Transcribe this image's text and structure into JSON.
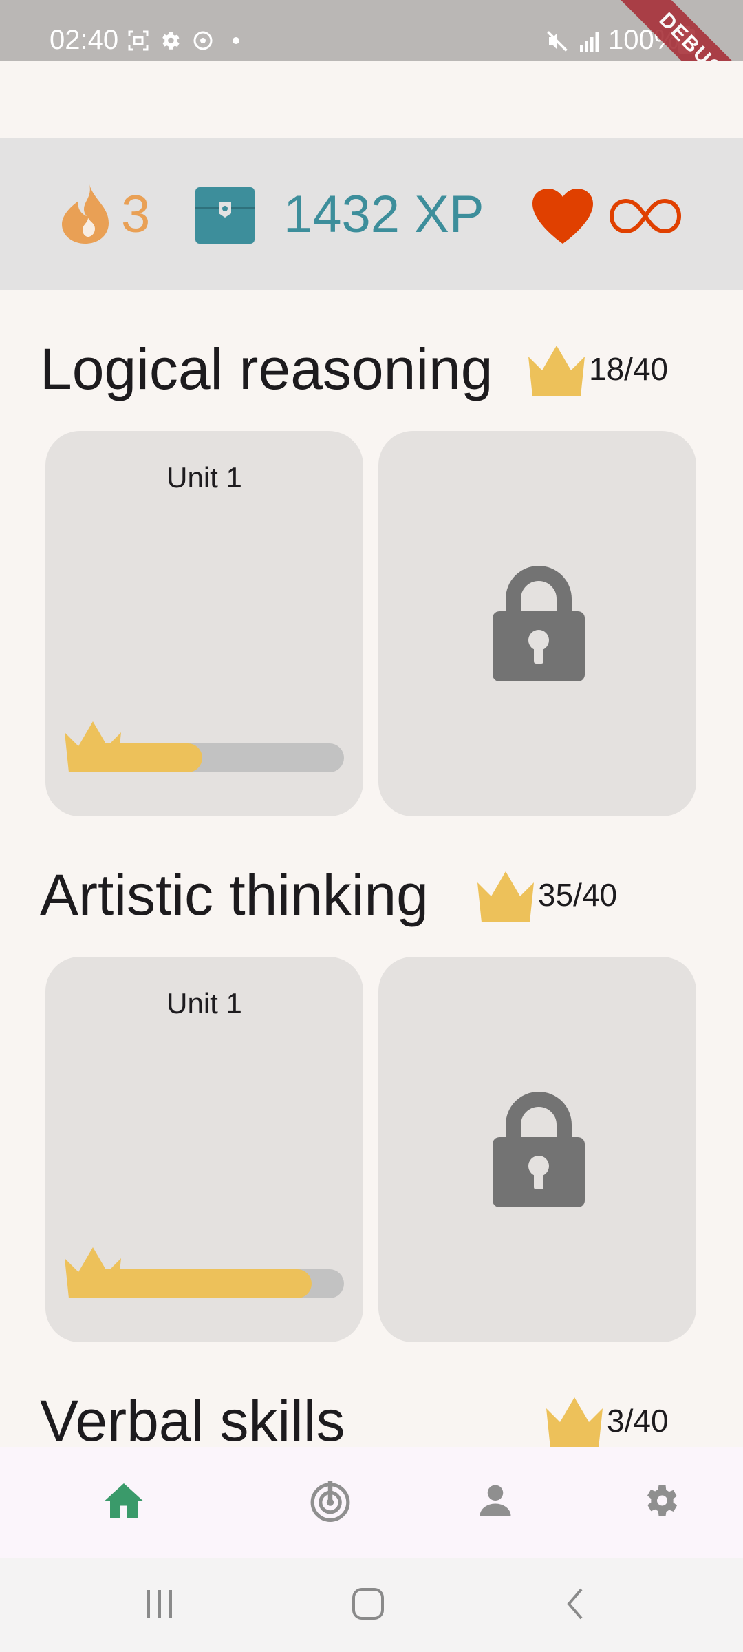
{
  "status_bar": {
    "time": "02:40",
    "battery": "100%"
  },
  "debug_banner": "DEBUG",
  "stats": {
    "streak": "3",
    "xp": "1432 XP",
    "lives": "∞",
    "colors": {
      "streak": "#e9a055",
      "xp": "#3d8e9b",
      "heart": "#e04000"
    }
  },
  "sections": [
    {
      "title": "Logical reasoning",
      "crowns": "18/40",
      "unit_label": "Unit 1",
      "unit_progress": 0.45
    },
    {
      "title": "Artistic thinking",
      "crowns": "35/40",
      "unit_label": "Unit 1",
      "unit_progress": 0.875
    },
    {
      "title": "Verbal skills",
      "crowns": "3/40"
    }
  ],
  "nav": {
    "items": [
      {
        "icon": "home-icon",
        "active": true
      },
      {
        "icon": "radar-icon",
        "active": false
      },
      {
        "icon": "profile-icon",
        "active": false
      },
      {
        "icon": "settings-icon",
        "active": false
      }
    ],
    "active_color": "#3a9a6a",
    "inactive_color": "#8f8f8f"
  },
  "system_nav": [
    "recent-apps-icon",
    "home-circle-icon",
    "back-icon"
  ]
}
